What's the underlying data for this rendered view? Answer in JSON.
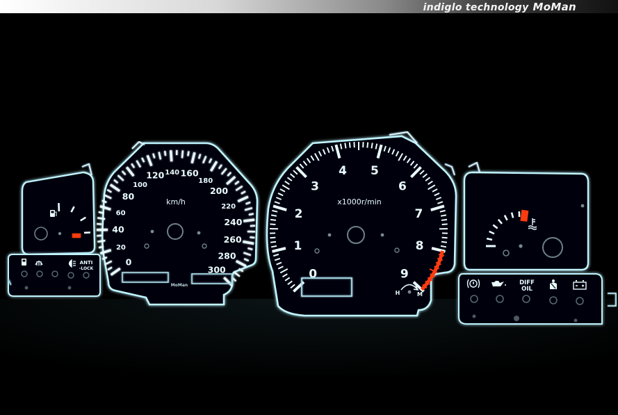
{
  "banner": {
    "tagline": "indiglo technology",
    "brand": "MoMan"
  },
  "colors": {
    "glow": "#bff4ff",
    "face": "#050607",
    "warning": "#ff3b10"
  },
  "speedometer": {
    "unit": "km/h",
    "brand": "MoMan",
    "scale_labels": [
      "0",
      "20",
      "40",
      "60",
      "80",
      "100",
      "120",
      "140",
      "160",
      "180",
      "200",
      "220",
      "240",
      "260",
      "280",
      "300"
    ]
  },
  "tachometer": {
    "unit": "x1000r/min",
    "scale_labels": [
      "0",
      "1",
      "2",
      "3",
      "4",
      "5",
      "6",
      "7",
      "8",
      "9"
    ],
    "redline_from": 8,
    "h_label": "H",
    "m_label": "M"
  },
  "fuel_gauge": {
    "icon": "fuel-pump-icon"
  },
  "temp_gauge": {
    "icon": "coolant-temp-icon"
  },
  "left_indicators": {
    "icons": [
      "fuel-warning-icon",
      "defroster-icon",
      "headlight-icon"
    ],
    "anti_lock_line1": "ANTI",
    "anti_lock_line2": "-LOCK"
  },
  "right_indicators": {
    "icons": [
      "brake-warning-icon",
      "oil-can-icon",
      "seatbelt-icon",
      "battery-icon"
    ],
    "diff_line1": "DIFF",
    "diff_line2": "OIL"
  }
}
